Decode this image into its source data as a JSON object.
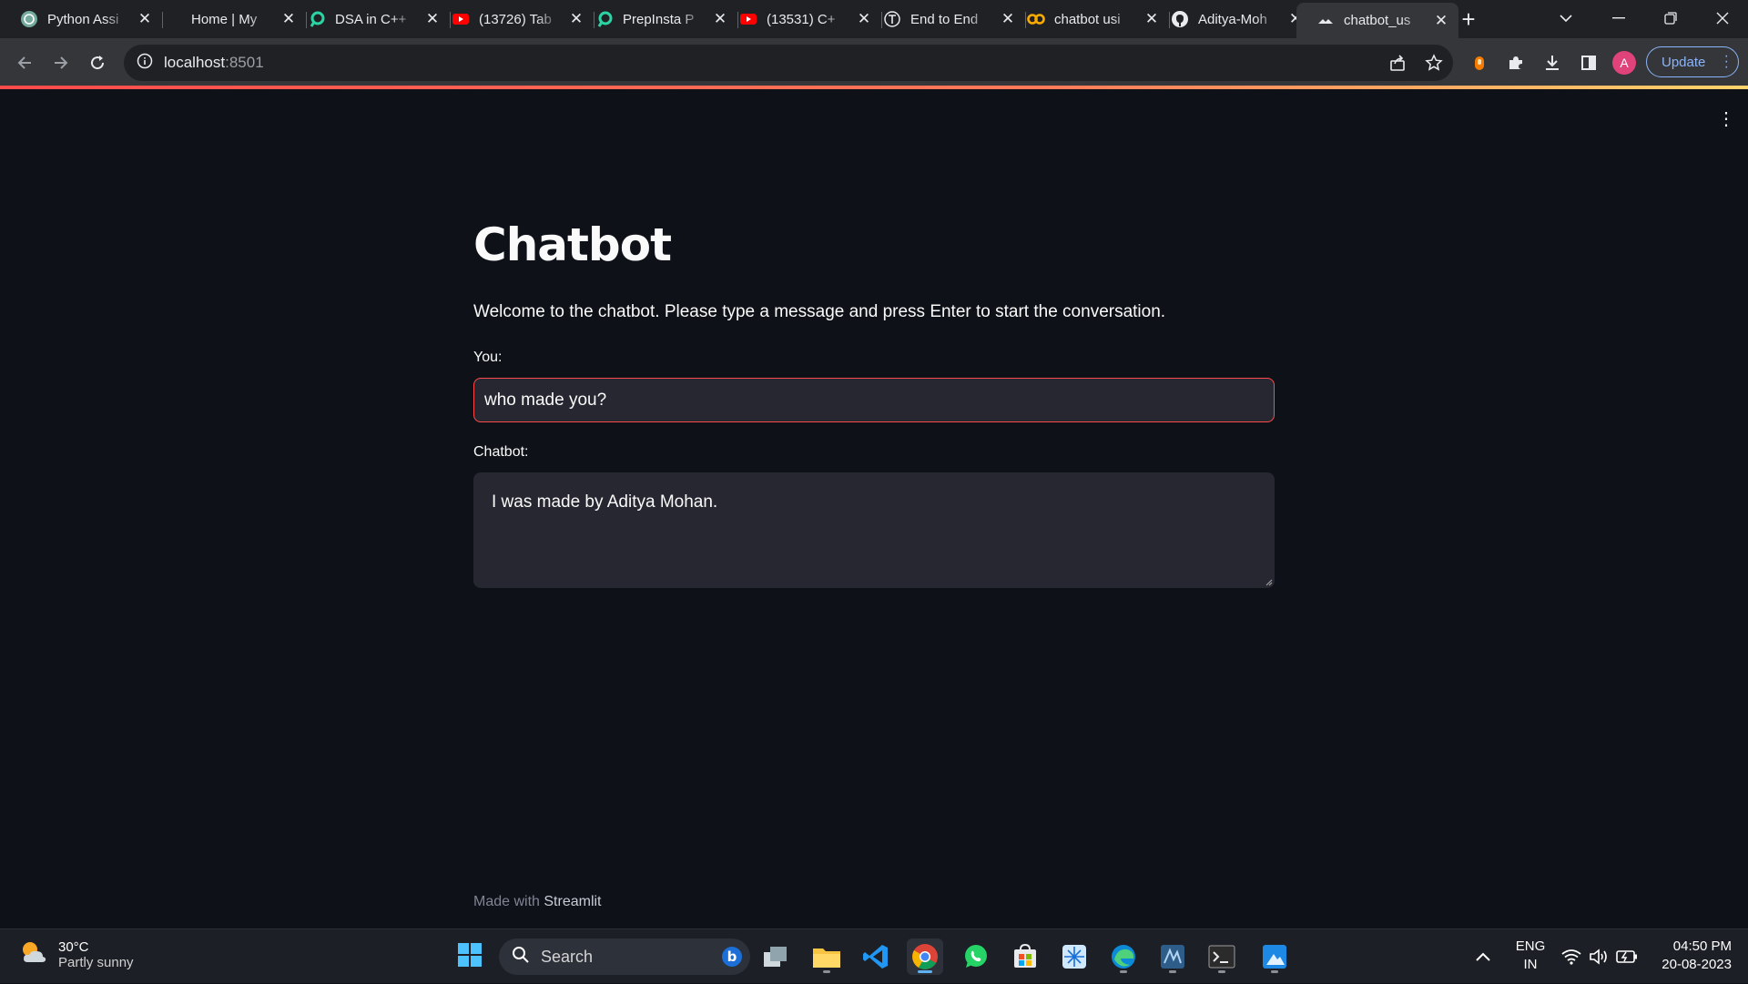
{
  "browser": {
    "tabs": [
      {
        "title": "Python Assi",
        "icon": "openai-icon"
      },
      {
        "title": "Home | My",
        "icon": "moon-icon"
      },
      {
        "title": "DSA in C++",
        "icon": "prepinsta-icon"
      },
      {
        "title": "(13726) Tab",
        "icon": "youtube-icon"
      },
      {
        "title": "PrepInsta P",
        "icon": "prepinsta-icon"
      },
      {
        "title": "(13531) C+",
        "icon": "youtube-icon"
      },
      {
        "title": "End to End",
        "icon": "medium-icon"
      },
      {
        "title": "chatbot usi",
        "icon": "colab-icon"
      },
      {
        "title": "Aditya-Moh",
        "icon": "github-icon"
      },
      {
        "title": "chatbot_us",
        "icon": "streamlit-icon"
      }
    ],
    "active_tab_index": 9,
    "url_host": "localhost",
    "url_port": ":8501",
    "profile_initial": "A",
    "update_label": "Update"
  },
  "app": {
    "title": "Chatbot",
    "welcome": "Welcome to the chatbot. Please type a message and press Enter to start the conversation.",
    "you_label": "You:",
    "you_value": "who made you?",
    "chatbot_label": "Chatbot:",
    "chatbot_value": "I was made by Aditya Mohan.",
    "footer_prefix": "Made with ",
    "footer_brand": "Streamlit",
    "accent_color": "#ff4b4b"
  },
  "taskbar": {
    "temperature": "30°C",
    "condition": "Partly sunny",
    "search_label": "Search",
    "lang_primary": "ENG",
    "lang_secondary": "IN",
    "time": "04:50 PM",
    "date": "20-08-2023"
  }
}
